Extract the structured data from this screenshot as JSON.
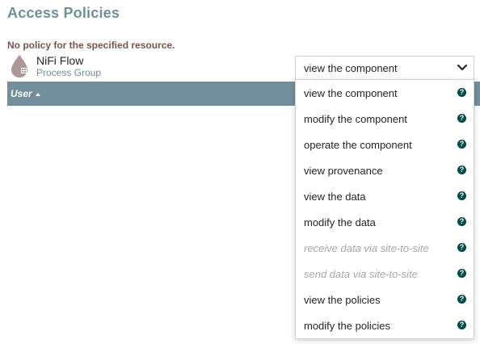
{
  "page": {
    "title": "Access Policies"
  },
  "message": "No policy for the specified resource.",
  "resource": {
    "name": "NiFi Flow",
    "type": "Process Group",
    "icon": "process-group-icon"
  },
  "table": {
    "columns": [
      {
        "label": "User",
        "sort": "ascending"
      }
    ]
  },
  "action_select": {
    "selected": "view the component",
    "expanded": true,
    "options": [
      {
        "label": "view the component",
        "enabled": true
      },
      {
        "label": "modify the component",
        "enabled": true
      },
      {
        "label": "operate the component",
        "enabled": true
      },
      {
        "label": "view provenance",
        "enabled": true
      },
      {
        "label": "view the data",
        "enabled": true
      },
      {
        "label": "modify the data",
        "enabled": true
      },
      {
        "label": "receive data via site-to-site",
        "enabled": false
      },
      {
        "label": "send data via site-to-site",
        "enabled": false
      },
      {
        "label": "view the policies",
        "enabled": true
      },
      {
        "label": "modify the policies",
        "enabled": true
      }
    ],
    "help_icon": "question-circle-icon",
    "chevron_icon": "chevron-down-icon"
  },
  "colors": {
    "title": "#728e9b",
    "message": "#775351",
    "header_bg": "#728e9b",
    "help_icon": "#004849",
    "disabled_text": "#a8a8a8"
  }
}
